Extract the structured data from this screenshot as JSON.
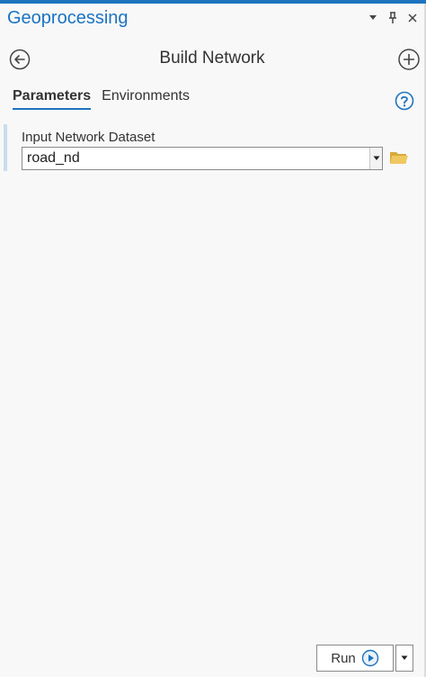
{
  "window": {
    "title": "Geoprocessing"
  },
  "tool": {
    "title": "Build Network"
  },
  "tabs": [
    {
      "label": "Parameters",
      "active": true
    },
    {
      "label": "Environments",
      "active": false
    }
  ],
  "parameters": [
    {
      "label": "Input Network Dataset",
      "value": "road_nd"
    }
  ],
  "footer": {
    "run_label": "Run"
  },
  "icons": {
    "title_controls": [
      "dropdown-arrow-icon",
      "pin-icon",
      "close-icon"
    ],
    "back": "back-arrow-icon",
    "add": "add-icon",
    "help": "help-icon",
    "browse": "folder-icon",
    "run": "play-icon"
  },
  "colors": {
    "accent": "#1e73be",
    "title": "#1a73c2",
    "folder": "#e0b54b"
  }
}
